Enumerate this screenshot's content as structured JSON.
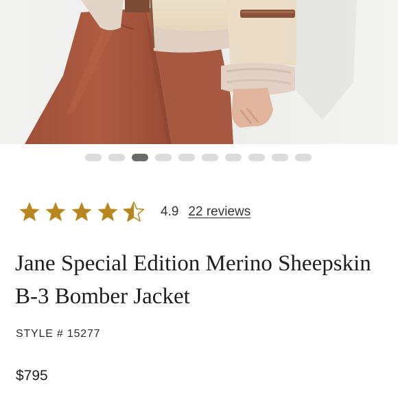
{
  "colors": {
    "star_gold": "#b8871f",
    "dot_active": "#6b6b6b",
    "dot_inactive": "#dcdcdc",
    "pants_rust": "#a9583f",
    "jacket_cream": "#e9dcc4",
    "shearling": "#e2d2c6",
    "strap_brown": "#8a5238"
  },
  "gallery": {
    "image_subject": "model-wearing-bomber-jacket",
    "slide_count": 10,
    "active_index": 2
  },
  "rating": {
    "score": 4.9,
    "score_label": "4.9",
    "max_stars": 5,
    "reviews_label": "22 reviews",
    "star_icons": [
      "star-full-icon",
      "star-full-icon",
      "star-full-icon",
      "star-full-icon",
      "star-half-icon"
    ]
  },
  "product": {
    "title": "Jane Special Edition Merino Sheepskin B-3 Bomber Jacket",
    "style_label": "STYLE # 15277",
    "price": "$795"
  }
}
